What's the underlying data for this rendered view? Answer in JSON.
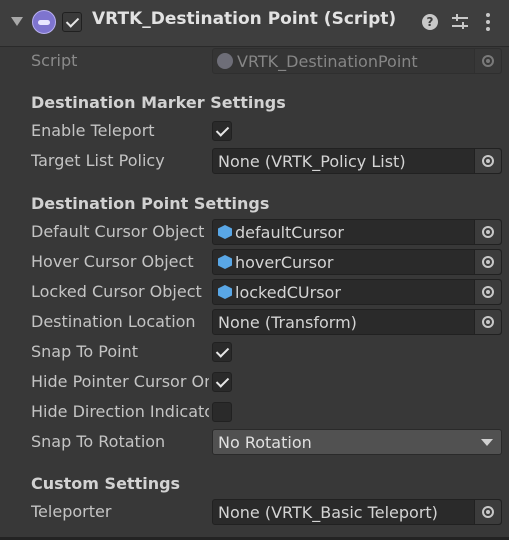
{
  "header": {
    "title": "VRTK_Destination Point (Script)",
    "enabled": true,
    "help_symbol": "?"
  },
  "script": {
    "label": "Script",
    "value": "VRTK_DestinationPoint"
  },
  "sections": {
    "marker": "Destination Marker Settings",
    "point": "Destination Point Settings",
    "custom": "Custom Settings"
  },
  "fields": {
    "enable_teleport": {
      "label": "Enable Teleport",
      "checked": true
    },
    "target_list_policy": {
      "label": "Target List Policy",
      "value": "None (VRTK_Policy List)"
    },
    "default_cursor": {
      "label": "Default Cursor Object",
      "value": "defaultCursor"
    },
    "hover_cursor": {
      "label": "Hover Cursor Object",
      "value": "hoverCursor"
    },
    "locked_cursor": {
      "label": "Locked Cursor Object",
      "value": "lockedCUrsor"
    },
    "destination_location": {
      "label": "Destination Location",
      "value": "None (Transform)"
    },
    "snap_to_point": {
      "label": "Snap To Point",
      "checked": true
    },
    "hide_pointer_cursor": {
      "label": "Hide Pointer Cursor On Hover",
      "checked": true
    },
    "hide_direction_indicator": {
      "label": "Hide Direction Indicator On Hover",
      "checked": false
    },
    "snap_to_rotation": {
      "label": "Snap To Rotation",
      "value": "No Rotation"
    },
    "teleporter": {
      "label": "Teleporter",
      "value": "None (VRTK_Basic Teleport)"
    }
  },
  "icons": {
    "foldout": "foldout-arrow-icon",
    "component": "script-component-icon",
    "help": "help-icon",
    "presets": "presets-icon",
    "menu": "kebab-menu-icon",
    "object": "gameobject-cube-icon",
    "picker": "object-picker-icon"
  },
  "colors": {
    "background": "#383838",
    "field": "#2a2a2a",
    "object_icon": "#59a7e6",
    "component_icon": "#7e74cf"
  }
}
